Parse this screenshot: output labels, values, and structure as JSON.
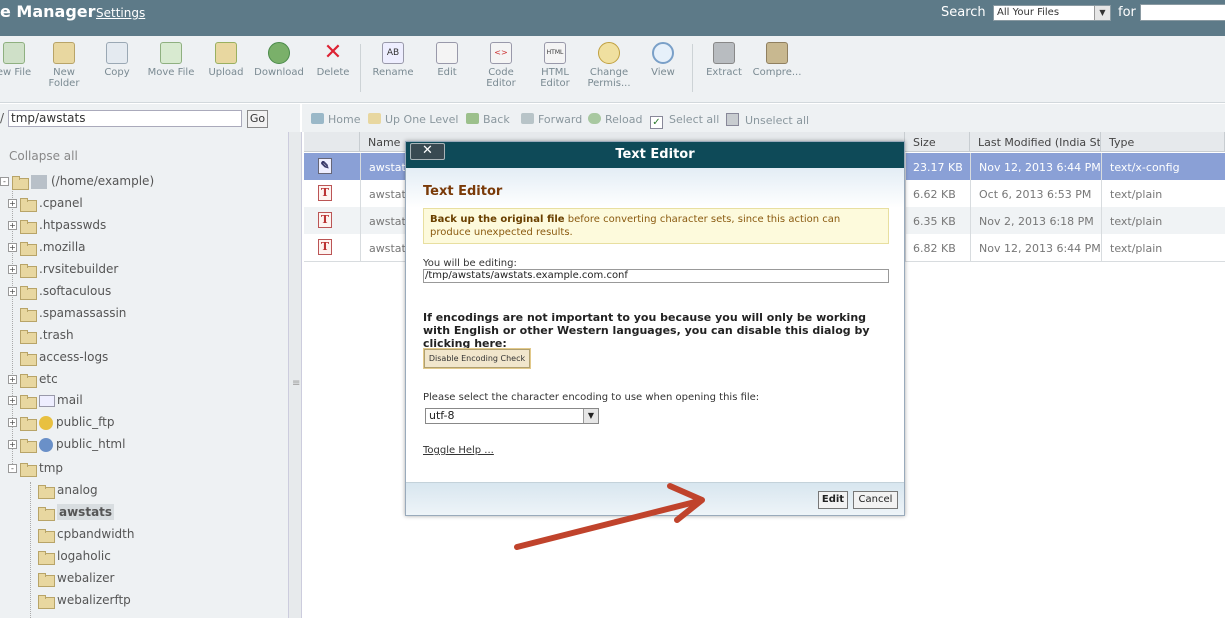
{
  "header": {
    "title": "e Manager",
    "settings": "Settings",
    "search_label": "Search",
    "search_scope": "All Your Files",
    "for_label": "for"
  },
  "toolbar": {
    "items": [
      {
        "label": "ew File",
        "icon": "new-file-icon"
      },
      {
        "label": "New\nFolder",
        "icon": "new-folder-icon"
      },
      {
        "label": "Copy",
        "icon": "copy-icon"
      },
      {
        "label": "Move File",
        "icon": "move-file-icon"
      },
      {
        "label": "Upload",
        "icon": "upload-icon"
      },
      {
        "label": "Download",
        "icon": "download-icon"
      },
      {
        "label": "Delete",
        "icon": "delete-icon"
      },
      {
        "label": "Rename",
        "icon": "rename-icon"
      },
      {
        "label": "Edit",
        "icon": "edit-icon"
      },
      {
        "label": "Code\nEditor",
        "icon": "code-editor-icon"
      },
      {
        "label": "HTML\nEditor",
        "icon": "html-editor-icon"
      },
      {
        "label": "Change\nPermis...",
        "icon": "key-icon"
      },
      {
        "label": "View",
        "icon": "magnifier-icon"
      },
      {
        "label": "Extract",
        "icon": "extract-icon"
      },
      {
        "label": "Compre...",
        "icon": "compress-icon"
      }
    ]
  },
  "pathbar": {
    "prefix": "/",
    "path": "tmp/awstats",
    "go": "Go"
  },
  "actions": {
    "home": "Home",
    "up": "Up One Level",
    "back": "Back",
    "forward": "Forward",
    "reload": "Reload",
    "select_all": "Select all",
    "unselect_all": "Unselect all"
  },
  "tree": {
    "collapse_all": "Collapse all",
    "root": "(/home/example)",
    "items": [
      {
        "label": ".cpanel",
        "expander": "+"
      },
      {
        "label": ".htpasswds",
        "expander": "+"
      },
      {
        "label": ".mozilla",
        "expander": "+"
      },
      {
        "label": ".rvsitebuilder",
        "expander": "+"
      },
      {
        "label": ".softaculous",
        "expander": "+"
      },
      {
        "label": ".spamassassin",
        "expander": ""
      },
      {
        "label": ".trash",
        "expander": ""
      },
      {
        "label": "access-logs",
        "expander": ""
      },
      {
        "label": "etc",
        "expander": "+"
      },
      {
        "label": "mail",
        "expander": "+"
      },
      {
        "label": "public_ftp",
        "expander": "+"
      },
      {
        "label": "public_html",
        "expander": "+"
      },
      {
        "label": "tmp",
        "expander": "-"
      }
    ],
    "tmp_children": [
      "analog",
      "awstats",
      "cpbandwidth",
      "logaholic",
      "webalizer",
      "webalizerftp"
    ]
  },
  "table": {
    "headers": [
      "Name",
      "Size",
      "Last Modified (India Standard Time)",
      "Type"
    ],
    "rows": [
      {
        "name": "awstats",
        "size": "23.17 KB",
        "modified": "Nov 12, 2013 6:44 PM",
        "type": "text/x-config"
      },
      {
        "name": "awstats",
        "size": "6.62 KB",
        "modified": "Oct 6, 2013 6:53 PM",
        "type": "text/plain"
      },
      {
        "name": "awstats",
        "size": "6.35 KB",
        "modified": "Nov 2, 2013 6:18 PM",
        "type": "text/plain"
      },
      {
        "name": "awstats",
        "size": "6.82 KB",
        "modified": "Nov 12, 2013 6:44 PM",
        "type": "text/plain"
      }
    ]
  },
  "modal": {
    "close": "✕",
    "title": "Text Editor",
    "heading": "Text Editor",
    "warn_bold": "Back up the original file",
    "warn_rest": " before converting character sets, since this action can produce unexpected results.",
    "editing_label": "You will be editing:",
    "editing_path": "/tmp/awstats/awstats.example.com.conf",
    "encoding_text": "If encodings are not important to you because you will only be working with English or other Western languages, you can disable this dialog by clicking here:",
    "disable_button": "Disable Encoding Check",
    "select_label": "Please select the character encoding to use when opening this file:",
    "encoding_value": "utf-8",
    "toggle_help": "Toggle Help ...",
    "edit_button": "Edit",
    "cancel_button": "Cancel"
  },
  "colors": {
    "header_bg": "#5d7a88",
    "modal_head": "#0e4a58",
    "selected_row": "#8aa0d6",
    "arrow": "#c0432c",
    "heading": "#7a3a08"
  }
}
